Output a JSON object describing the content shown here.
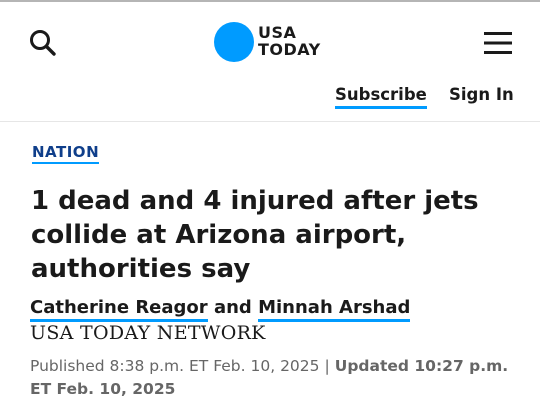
{
  "brand": {
    "line1": "USA",
    "line2": "TODAY",
    "dot_color": "#009bff"
  },
  "icons": {
    "search": "search-icon",
    "menu": "hamburger-menu-icon"
  },
  "header": {
    "subscribe_label": "Subscribe",
    "signin_label": "Sign In"
  },
  "article": {
    "section": "NATION",
    "headline": "1 dead and 4 injured after jets collide at Arizona airport, authorities say",
    "authors": [
      "Catherine Reagor",
      "Minnah Arshad"
    ],
    "author_joiner": "and",
    "network": "USA TODAY NETWORK",
    "published": "Published 8:38 p.m. ET Feb. 10, 2025",
    "separator": "|",
    "updated": "Updated 10:27 p.m. ET Feb. 10, 2025"
  },
  "colors": {
    "accent": "#009bff",
    "section": "#0f3e8a",
    "meta": "#666666"
  }
}
